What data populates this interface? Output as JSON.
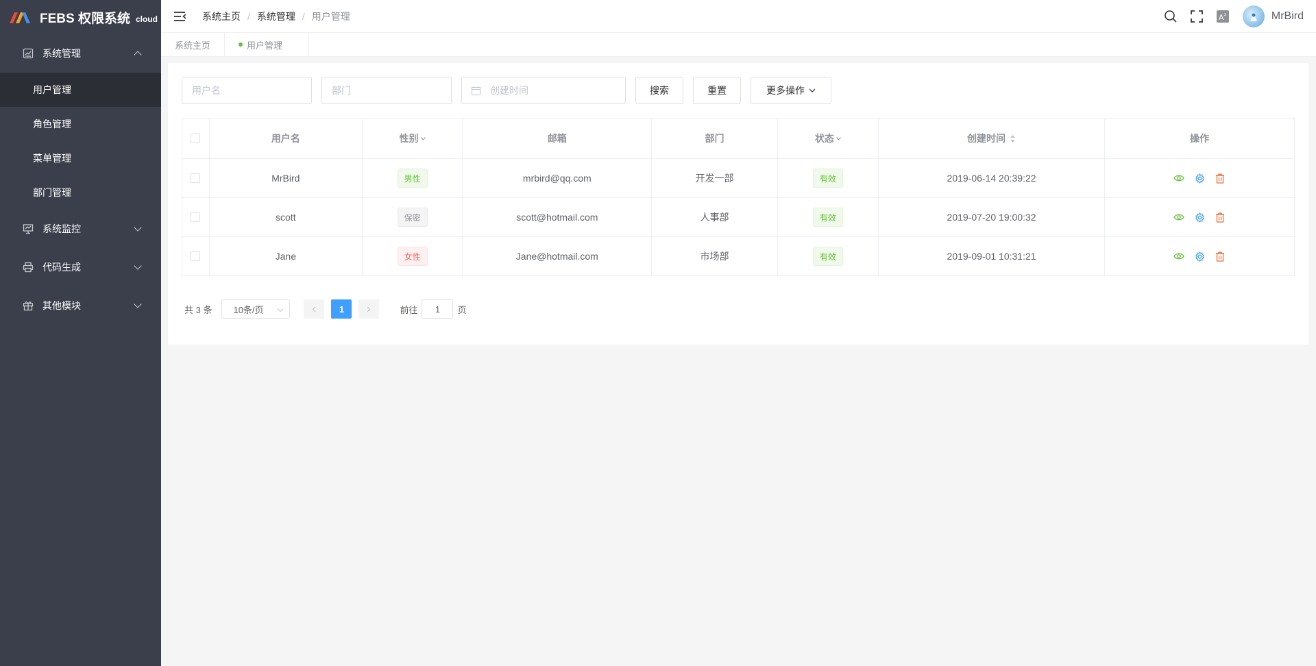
{
  "app": {
    "logo_text": "FEBS 权限系统",
    "logo_suffix": "cloud"
  },
  "sidebar": {
    "groups": [
      {
        "label": "系统管理",
        "icon": "system-management-icon",
        "expanded": true,
        "items": [
          {
            "label": "用户管理",
            "active": true
          },
          {
            "label": "角色管理",
            "active": false
          },
          {
            "label": "菜单管理",
            "active": false
          },
          {
            "label": "部门管理",
            "active": false
          }
        ]
      },
      {
        "label": "系统监控",
        "icon": "monitor-icon",
        "expanded": false
      },
      {
        "label": "代码生成",
        "icon": "printer-icon",
        "expanded": false
      },
      {
        "label": "其他模块",
        "icon": "gift-icon",
        "expanded": false
      }
    ]
  },
  "header": {
    "breadcrumb": [
      "系统主页",
      "系统管理",
      "用户管理"
    ],
    "username": "MrBird"
  },
  "tabs": [
    {
      "label": "系统主页",
      "active": false
    },
    {
      "label": "用户管理",
      "active": true
    }
  ],
  "filters": {
    "username_placeholder": "用户名",
    "dept_placeholder": "部门",
    "date_placeholder": "创建时间",
    "search_label": "搜索",
    "reset_label": "重置",
    "more_label": "更多操作"
  },
  "table": {
    "columns": [
      "用户名",
      "性别",
      "邮箱",
      "部门",
      "状态",
      "创建时间",
      "操作"
    ],
    "rows": [
      {
        "username": "MrBird",
        "gender": "男性",
        "gender_type": "male",
        "email": "mrbird@qq.com",
        "dept": "开发一部",
        "status": "有效",
        "created": "2019-06-14 20:39:22"
      },
      {
        "username": "scott",
        "gender": "保密",
        "gender_type": "secret",
        "email": "scott@hotmail.com",
        "dept": "人事部",
        "status": "有效",
        "created": "2019-07-20 19:00:32"
      },
      {
        "username": "Jane",
        "gender": "女性",
        "gender_type": "female",
        "email": "Jane@hotmail.com",
        "dept": "市场部",
        "status": "有效",
        "created": "2019-09-01 10:31:21"
      }
    ]
  },
  "pagination": {
    "total_text": "共 3 条",
    "page_size": "10条/页",
    "current_page": "1",
    "goto_prefix": "前往",
    "goto_value": "1",
    "goto_suffix": "页"
  },
  "colors": {
    "sidebar_bg": "#3a3f4b",
    "sidebar_active_bg": "#2b2e34",
    "primary": "#409eff",
    "success": "#67c23a",
    "danger": "#f56c6c",
    "warning_delete": "#e6733c"
  }
}
